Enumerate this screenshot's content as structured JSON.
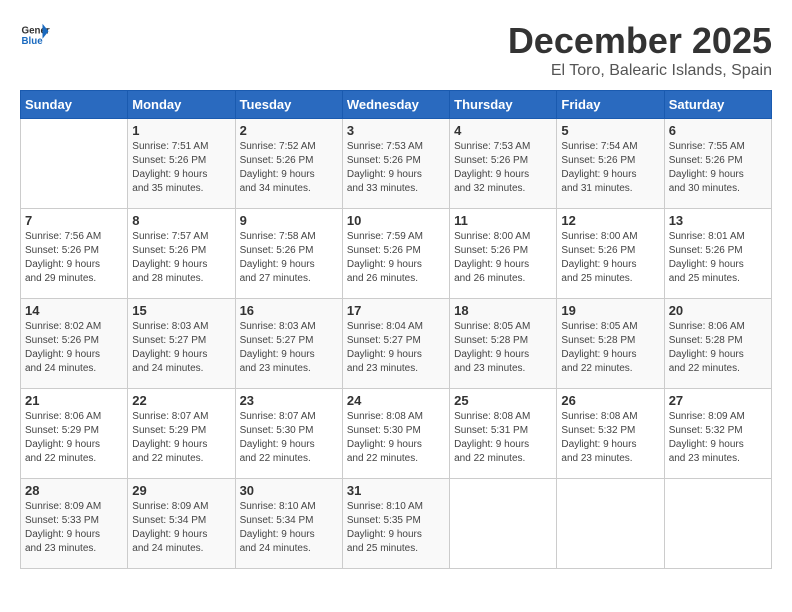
{
  "header": {
    "logo_general": "General",
    "logo_blue": "Blue",
    "month_title": "December 2025",
    "location": "El Toro, Balearic Islands, Spain"
  },
  "calendar": {
    "days_of_week": [
      "Sunday",
      "Monday",
      "Tuesday",
      "Wednesday",
      "Thursday",
      "Friday",
      "Saturday"
    ],
    "weeks": [
      [
        {
          "day": "",
          "info": ""
        },
        {
          "day": "1",
          "info": "Sunrise: 7:51 AM\nSunset: 5:26 PM\nDaylight: 9 hours\nand 35 minutes."
        },
        {
          "day": "2",
          "info": "Sunrise: 7:52 AM\nSunset: 5:26 PM\nDaylight: 9 hours\nand 34 minutes."
        },
        {
          "day": "3",
          "info": "Sunrise: 7:53 AM\nSunset: 5:26 PM\nDaylight: 9 hours\nand 33 minutes."
        },
        {
          "day": "4",
          "info": "Sunrise: 7:53 AM\nSunset: 5:26 PM\nDaylight: 9 hours\nand 32 minutes."
        },
        {
          "day": "5",
          "info": "Sunrise: 7:54 AM\nSunset: 5:26 PM\nDaylight: 9 hours\nand 31 minutes."
        },
        {
          "day": "6",
          "info": "Sunrise: 7:55 AM\nSunset: 5:26 PM\nDaylight: 9 hours\nand 30 minutes."
        }
      ],
      [
        {
          "day": "7",
          "info": "Sunrise: 7:56 AM\nSunset: 5:26 PM\nDaylight: 9 hours\nand 29 minutes."
        },
        {
          "day": "8",
          "info": "Sunrise: 7:57 AM\nSunset: 5:26 PM\nDaylight: 9 hours\nand 28 minutes."
        },
        {
          "day": "9",
          "info": "Sunrise: 7:58 AM\nSunset: 5:26 PM\nDaylight: 9 hours\nand 27 minutes."
        },
        {
          "day": "10",
          "info": "Sunrise: 7:59 AM\nSunset: 5:26 PM\nDaylight: 9 hours\nand 26 minutes."
        },
        {
          "day": "11",
          "info": "Sunrise: 8:00 AM\nSunset: 5:26 PM\nDaylight: 9 hours\nand 26 minutes."
        },
        {
          "day": "12",
          "info": "Sunrise: 8:00 AM\nSunset: 5:26 PM\nDaylight: 9 hours\nand 25 minutes."
        },
        {
          "day": "13",
          "info": "Sunrise: 8:01 AM\nSunset: 5:26 PM\nDaylight: 9 hours\nand 25 minutes."
        }
      ],
      [
        {
          "day": "14",
          "info": "Sunrise: 8:02 AM\nSunset: 5:26 PM\nDaylight: 9 hours\nand 24 minutes."
        },
        {
          "day": "15",
          "info": "Sunrise: 8:03 AM\nSunset: 5:27 PM\nDaylight: 9 hours\nand 24 minutes."
        },
        {
          "day": "16",
          "info": "Sunrise: 8:03 AM\nSunset: 5:27 PM\nDaylight: 9 hours\nand 23 minutes."
        },
        {
          "day": "17",
          "info": "Sunrise: 8:04 AM\nSunset: 5:27 PM\nDaylight: 9 hours\nand 23 minutes."
        },
        {
          "day": "18",
          "info": "Sunrise: 8:05 AM\nSunset: 5:28 PM\nDaylight: 9 hours\nand 23 minutes."
        },
        {
          "day": "19",
          "info": "Sunrise: 8:05 AM\nSunset: 5:28 PM\nDaylight: 9 hours\nand 22 minutes."
        },
        {
          "day": "20",
          "info": "Sunrise: 8:06 AM\nSunset: 5:28 PM\nDaylight: 9 hours\nand 22 minutes."
        }
      ],
      [
        {
          "day": "21",
          "info": "Sunrise: 8:06 AM\nSunset: 5:29 PM\nDaylight: 9 hours\nand 22 minutes."
        },
        {
          "day": "22",
          "info": "Sunrise: 8:07 AM\nSunset: 5:29 PM\nDaylight: 9 hours\nand 22 minutes."
        },
        {
          "day": "23",
          "info": "Sunrise: 8:07 AM\nSunset: 5:30 PM\nDaylight: 9 hours\nand 22 minutes."
        },
        {
          "day": "24",
          "info": "Sunrise: 8:08 AM\nSunset: 5:30 PM\nDaylight: 9 hours\nand 22 minutes."
        },
        {
          "day": "25",
          "info": "Sunrise: 8:08 AM\nSunset: 5:31 PM\nDaylight: 9 hours\nand 22 minutes."
        },
        {
          "day": "26",
          "info": "Sunrise: 8:08 AM\nSunset: 5:32 PM\nDaylight: 9 hours\nand 23 minutes."
        },
        {
          "day": "27",
          "info": "Sunrise: 8:09 AM\nSunset: 5:32 PM\nDaylight: 9 hours\nand 23 minutes."
        }
      ],
      [
        {
          "day": "28",
          "info": "Sunrise: 8:09 AM\nSunset: 5:33 PM\nDaylight: 9 hours\nand 23 minutes."
        },
        {
          "day": "29",
          "info": "Sunrise: 8:09 AM\nSunset: 5:34 PM\nDaylight: 9 hours\nand 24 minutes."
        },
        {
          "day": "30",
          "info": "Sunrise: 8:10 AM\nSunset: 5:34 PM\nDaylight: 9 hours\nand 24 minutes."
        },
        {
          "day": "31",
          "info": "Sunrise: 8:10 AM\nSunset: 5:35 PM\nDaylight: 9 hours\nand 25 minutes."
        },
        {
          "day": "",
          "info": ""
        },
        {
          "day": "",
          "info": ""
        },
        {
          "day": "",
          "info": ""
        }
      ]
    ]
  }
}
